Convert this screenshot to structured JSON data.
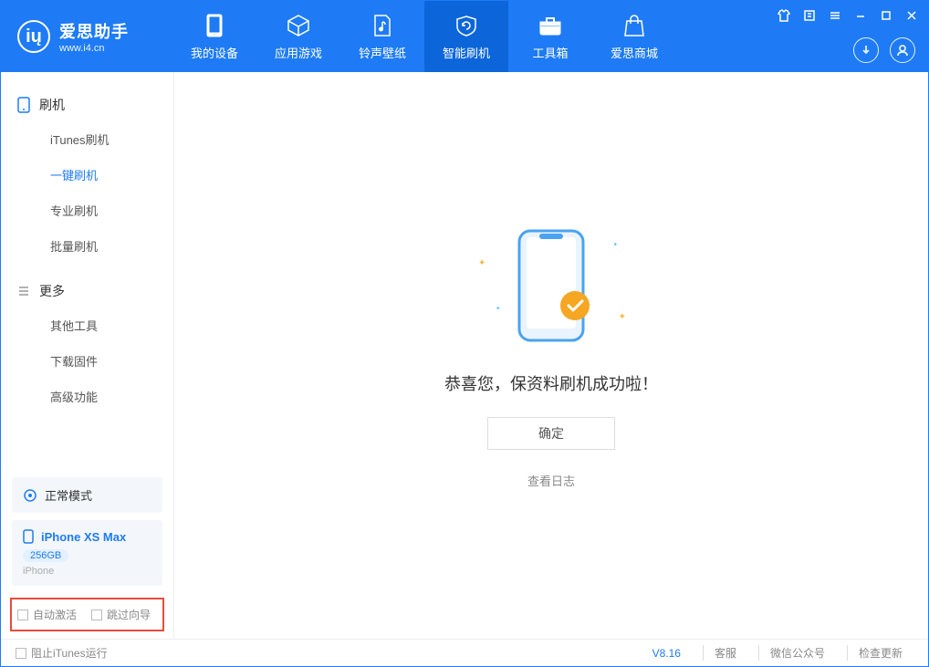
{
  "app": {
    "title": "爱思助手",
    "subtitle": "www.i4.cn"
  },
  "nav": [
    {
      "label": "我的设备"
    },
    {
      "label": "应用游戏"
    },
    {
      "label": "铃声壁纸"
    },
    {
      "label": "智能刷机"
    },
    {
      "label": "工具箱"
    },
    {
      "label": "爱思商城"
    }
  ],
  "sidebar": {
    "sec1": {
      "title": "刷机",
      "items": [
        "iTunes刷机",
        "一键刷机",
        "专业刷机",
        "批量刷机"
      ],
      "activeIndex": 1
    },
    "sec2": {
      "title": "更多",
      "items": [
        "其他工具",
        "下载固件",
        "高级功能"
      ]
    }
  },
  "device": {
    "mode": "正常模式",
    "name": "iPhone XS Max",
    "capacity": "256GB",
    "type": "iPhone"
  },
  "checks": {
    "autoActivate": "自动激活",
    "skipGuide": "跳过向导"
  },
  "main": {
    "successText": "恭喜您，保资料刷机成功啦！",
    "okBtn": "确定",
    "viewLog": "查看日志"
  },
  "footer": {
    "blockItunes": "阻止iTunes运行",
    "version": "V8.16",
    "links": [
      "客服",
      "微信公众号",
      "检查更新"
    ]
  }
}
